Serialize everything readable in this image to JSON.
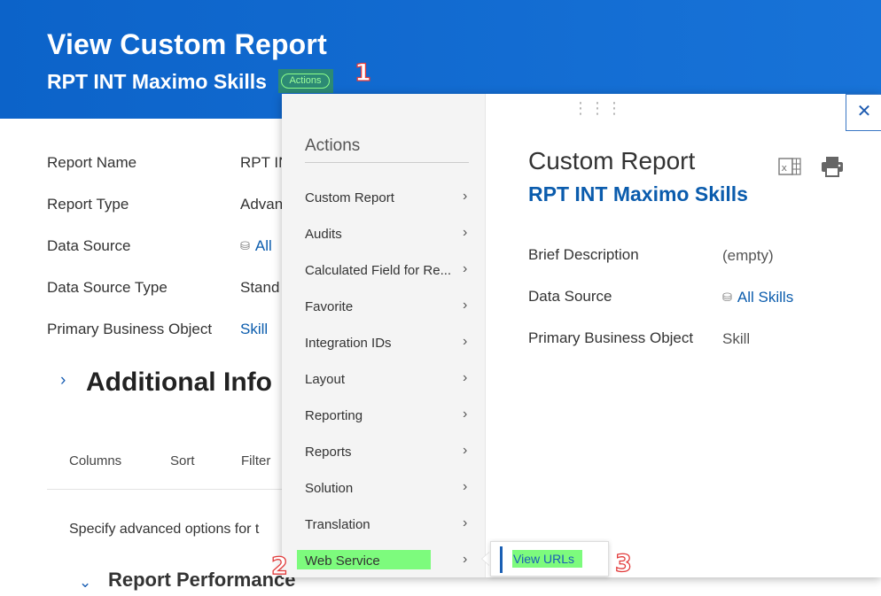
{
  "header": {
    "title": "View Custom Report",
    "subtitle": "RPT INT Maximo Skills",
    "actions_button": "Actions",
    "brand_color": "#0c63c9"
  },
  "callouts": [
    "1",
    "2",
    "3"
  ],
  "details": [
    {
      "label": "Report Name",
      "value": "RPT IN"
    },
    {
      "label": "Report Type",
      "value": "Advan"
    },
    {
      "label": "Data Source",
      "value": "All",
      "icon": "database-icon"
    },
    {
      "label": "Data Source Type",
      "value": "Stand"
    },
    {
      "label": "Primary Business Object",
      "value": "Skill"
    }
  ],
  "additional_info": {
    "heading": "Additional Info",
    "tabs": [
      "Columns",
      "Sort",
      "Filter"
    ],
    "advanced_text": "Specify advanced options for t",
    "performance_heading": "Report Performance"
  },
  "menu": {
    "title": "Actions",
    "items": [
      "Custom Report",
      "Audits",
      "Calculated Field for Re...",
      "Favorite",
      "Integration IDs",
      "Layout",
      "Reporting",
      "Reports",
      "Solution",
      "Translation",
      "Web Service"
    ],
    "highlight_color": "#7dfb7d"
  },
  "detail_panel": {
    "title": "Custom Report",
    "subtitle": "RPT INT Maximo Skills",
    "rows": [
      {
        "label": "Brief Description",
        "value": "(empty)"
      },
      {
        "label": "Data Source",
        "value": "All Skills",
        "icon": "database-icon"
      },
      {
        "label": "Primary Business Object",
        "value": "Skill"
      }
    ],
    "icons": [
      "excel-export-icon",
      "print-icon",
      "close-icon",
      "drag-handle-icon"
    ]
  },
  "submenu": {
    "items": [
      "View URLs"
    ]
  }
}
